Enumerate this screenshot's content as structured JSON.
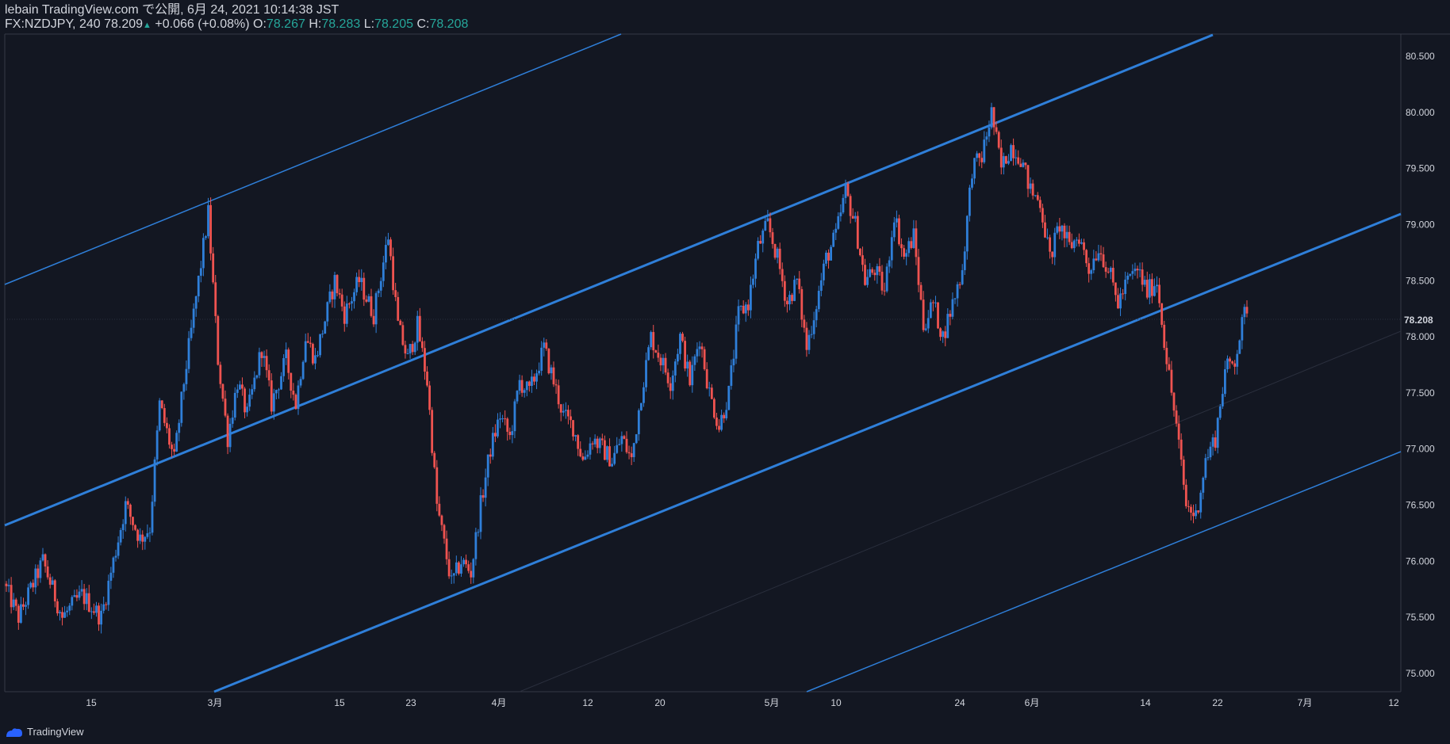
{
  "header": {
    "line1": "lebain TradingView.com で公開, 6月 24, 2021 10:14:38 JST",
    "symbol": "FX:NZDJPY, 240",
    "last": "78.209",
    "change": "+0.066 (+0.08%)",
    "o_label": "O:",
    "o_value": "78.267",
    "h_label": "H:",
    "h_value": "78.283",
    "l_label": "L:",
    "l_value": "78.205",
    "c_label": "C:",
    "c_value": "78.208"
  },
  "footer": {
    "brand": "TradingView"
  },
  "colors": {
    "background": "#131722",
    "up": "#2f7fd9",
    "down": "#ef5350",
    "channel": "#2f7fd9",
    "axis": "#d1d4dc",
    "price_tag": "#131722"
  },
  "chart_data": {
    "type": "candlestick",
    "title": "",
    "symbol": "FX:NZDJPY",
    "interval": "240",
    "last_price_label": "78.208",
    "ylim": [
      74.8,
      80.8
    ],
    "y_ticks": [
      "75.000",
      "75.500",
      "76.000",
      "76.500",
      "77.000",
      "77.500",
      "78.000",
      "78.500",
      "79.000",
      "79.500",
      "80.000",
      "80.500"
    ],
    "x_ticks": [
      "15",
      "3月",
      "15",
      "23",
      "4月",
      "12",
      "20",
      "5月",
      "10",
      "24",
      "6月",
      "14",
      "22",
      "7月",
      "12"
    ],
    "grid": false,
    "anchors": [
      {
        "t": 0,
        "p": 75.8
      },
      {
        "t": 1.5,
        "p": 75.5
      },
      {
        "t": 4,
        "p": 76.0
      },
      {
        "t": 6,
        "p": 75.5
      },
      {
        "t": 8,
        "p": 75.7
      },
      {
        "t": 10,
        "p": 75.5
      },
      {
        "t": 11,
        "p": 75.9
      },
      {
        "t": 12.5,
        "p": 76.5
      },
      {
        "t": 14,
        "p": 76.2
      },
      {
        "t": 15,
        "p": 76.3
      },
      {
        "t": 16,
        "p": 77.4
      },
      {
        "t": 17.5,
        "p": 76.9
      },
      {
        "t": 18.5,
        "p": 77.6
      },
      {
        "t": 20,
        "p": 78.5
      },
      {
        "t": 21,
        "p": 79.1
      },
      {
        "t": 22,
        "p": 77.8
      },
      {
        "t": 23,
        "p": 77.1
      },
      {
        "t": 24,
        "p": 77.6
      },
      {
        "t": 25,
        "p": 77.3
      },
      {
        "t": 26.5,
        "p": 77.9
      },
      {
        "t": 27.5,
        "p": 77.4
      },
      {
        "t": 29,
        "p": 77.8
      },
      {
        "t": 30,
        "p": 77.4
      },
      {
        "t": 31,
        "p": 78.0
      },
      {
        "t": 32,
        "p": 77.8
      },
      {
        "t": 34,
        "p": 78.5
      },
      {
        "t": 35,
        "p": 78.2
      },
      {
        "t": 36.5,
        "p": 78.5
      },
      {
        "t": 38,
        "p": 78.2
      },
      {
        "t": 39.5,
        "p": 78.9
      },
      {
        "t": 40.5,
        "p": 78.1
      },
      {
        "t": 41.5,
        "p": 77.8
      },
      {
        "t": 42.5,
        "p": 78.1
      },
      {
        "t": 43.5,
        "p": 77.6
      },
      {
        "t": 44.5,
        "p": 76.5
      },
      {
        "t": 46,
        "p": 75.8
      },
      {
        "t": 47,
        "p": 76.0
      },
      {
        "t": 48,
        "p": 75.9
      },
      {
        "t": 49,
        "p": 76.5
      },
      {
        "t": 50,
        "p": 77.0
      },
      {
        "t": 51,
        "p": 77.3
      },
      {
        "t": 52,
        "p": 77.1
      },
      {
        "t": 53,
        "p": 77.6
      },
      {
        "t": 54,
        "p": 77.5
      },
      {
        "t": 55.5,
        "p": 77.9
      },
      {
        "t": 56.5,
        "p": 77.6
      },
      {
        "t": 57.5,
        "p": 77.3
      },
      {
        "t": 58.5,
        "p": 77.2
      },
      {
        "t": 59.5,
        "p": 76.9
      },
      {
        "t": 60.5,
        "p": 77.1
      },
      {
        "t": 61.5,
        "p": 77.0
      },
      {
        "t": 62.5,
        "p": 76.9
      },
      {
        "t": 63.5,
        "p": 77.1
      },
      {
        "t": 64.5,
        "p": 76.9
      },
      {
        "t": 65.5,
        "p": 77.5
      },
      {
        "t": 66.5,
        "p": 78.0
      },
      {
        "t": 67.5,
        "p": 77.8
      },
      {
        "t": 68.5,
        "p": 77.6
      },
      {
        "t": 69.5,
        "p": 78.0
      },
      {
        "t": 70.5,
        "p": 77.6
      },
      {
        "t": 71.5,
        "p": 78.0
      },
      {
        "t": 72.5,
        "p": 77.5
      },
      {
        "t": 73.5,
        "p": 77.2
      },
      {
        "t": 74.5,
        "p": 77.5
      },
      {
        "t": 75.5,
        "p": 78.2
      },
      {
        "t": 76.5,
        "p": 78.3
      },
      {
        "t": 77.5,
        "p": 78.8
      },
      {
        "t": 78.5,
        "p": 79.0
      },
      {
        "t": 79.5,
        "p": 78.7
      },
      {
        "t": 80.5,
        "p": 78.3
      },
      {
        "t": 81.5,
        "p": 78.5
      },
      {
        "t": 82.5,
        "p": 77.9
      },
      {
        "t": 83.5,
        "p": 78.3
      },
      {
        "t": 84.5,
        "p": 78.7
      },
      {
        "t": 85.5,
        "p": 78.9
      },
      {
        "t": 86.5,
        "p": 79.3
      },
      {
        "t": 87.5,
        "p": 79.0
      },
      {
        "t": 88.5,
        "p": 78.5
      },
      {
        "t": 89.5,
        "p": 78.6
      },
      {
        "t": 90.5,
        "p": 78.4
      },
      {
        "t": 91.5,
        "p": 79.1
      },
      {
        "t": 92.5,
        "p": 78.7
      },
      {
        "t": 93.5,
        "p": 78.9
      },
      {
        "t": 94.5,
        "p": 78.1
      },
      {
        "t": 95.5,
        "p": 78.3
      },
      {
        "t": 96.5,
        "p": 78.0
      },
      {
        "t": 97.5,
        "p": 78.3
      },
      {
        "t": 98.5,
        "p": 78.6
      },
      {
        "t": 99.5,
        "p": 79.5
      },
      {
        "t": 100.5,
        "p": 79.6
      },
      {
        "t": 101.5,
        "p": 80.0
      },
      {
        "t": 102.5,
        "p": 79.5
      },
      {
        "t": 103.5,
        "p": 79.7
      },
      {
        "t": 104.5,
        "p": 79.6
      },
      {
        "t": 105.5,
        "p": 79.3
      },
      {
        "t": 106.5,
        "p": 79.2
      },
      {
        "t": 107.5,
        "p": 78.7
      },
      {
        "t": 108.5,
        "p": 79.0
      },
      {
        "t": 109.5,
        "p": 78.8
      },
      {
        "t": 110.5,
        "p": 78.9
      },
      {
        "t": 111.5,
        "p": 78.6
      },
      {
        "t": 112.5,
        "p": 78.8
      },
      {
        "t": 113.5,
        "p": 78.6
      },
      {
        "t": 114.5,
        "p": 78.3
      },
      {
        "t": 115.5,
        "p": 78.5
      },
      {
        "t": 116.5,
        "p": 78.6
      },
      {
        "t": 117.5,
        "p": 78.4
      },
      {
        "t": 118.5,
        "p": 78.5
      },
      {
        "t": 119.5,
        "p": 77.8
      },
      {
        "t": 120.5,
        "p": 77.2
      },
      {
        "t": 121.5,
        "p": 76.5
      },
      {
        "t": 122.5,
        "p": 76.4
      },
      {
        "t": 123.5,
        "p": 76.9
      },
      {
        "t": 124.5,
        "p": 77.1
      },
      {
        "t": 125.5,
        "p": 77.7
      },
      {
        "t": 126.5,
        "p": 77.8
      },
      {
        "t": 127.5,
        "p": 78.2
      }
    ]
  }
}
